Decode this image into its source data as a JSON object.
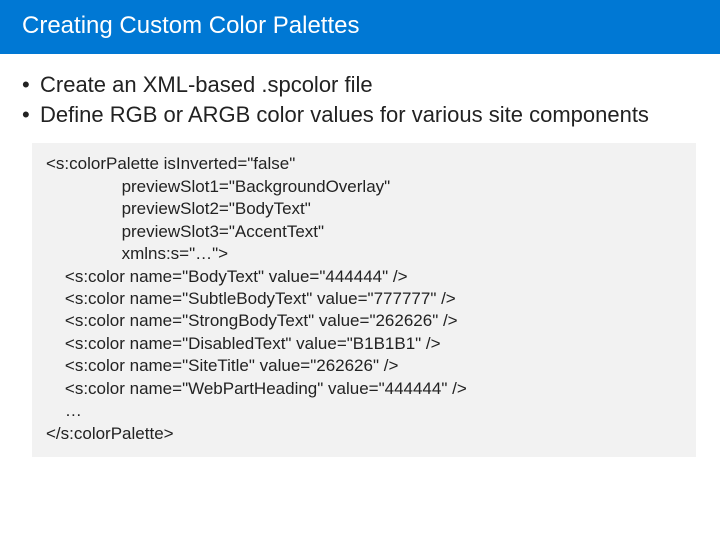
{
  "header": {
    "title": "Creating Custom Color Palettes"
  },
  "bullets": {
    "items": [
      "Create an XML-based .spcolor file",
      "Define RGB or ARGB color values for various site components"
    ]
  },
  "code": {
    "l1": "<s:colorPalette isInverted=\"false\"",
    "l2": "                previewSlot1=\"BackgroundOverlay\"",
    "l3": "                previewSlot2=\"BodyText\"",
    "l4": "                previewSlot3=\"AccentText\"",
    "l5": "                xmlns:s=\"…\">",
    "l6": "    <s:color name=\"BodyText\" value=\"444444\" />",
    "l7": "    <s:color name=\"SubtleBodyText\" value=\"777777\" />",
    "l8": "    <s:color name=\"StrongBodyText\" value=\"262626\" />",
    "l9": "    <s:color name=\"DisabledText\" value=\"B1B1B1\" />",
    "l10": "    <s:color name=\"SiteTitle\" value=\"262626\" />",
    "l11": "    <s:color name=\"WebPartHeading\" value=\"444444\" />",
    "l12": "    …",
    "l13": "</s:colorPalette>"
  }
}
